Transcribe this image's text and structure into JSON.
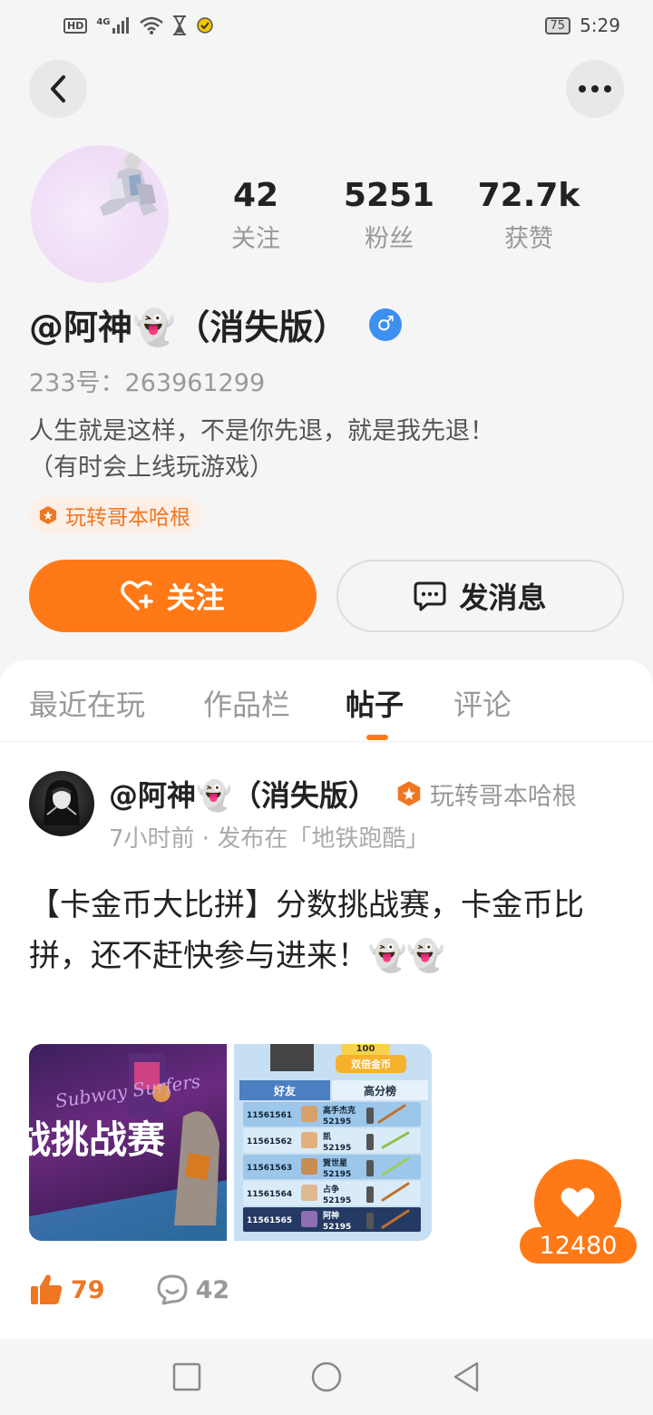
{
  "status_bar": {
    "left_icons": [
      "hd-icon",
      "4g-signal-icon",
      "wifi-icon",
      "hourglass-icon",
      "notification-icon"
    ],
    "hd_label": "HD",
    "network_label": "4G",
    "battery": "75",
    "time": "5:29"
  },
  "header": {
    "back_icon": "chevron-left-icon",
    "more_icon": "more-dots-icon"
  },
  "profile": {
    "stats": [
      {
        "value": "42",
        "label": "关注"
      },
      {
        "value": "5251",
        "label": "粉丝"
      },
      {
        "value": "72.7k",
        "label": "获赞"
      }
    ],
    "username": "@阿神👻（消失版）",
    "gender_icon": "male-icon",
    "gender_symbol": "♂",
    "id_line": "233号：263961299",
    "bio_line1": "人生就是这样，不是你先退，就是我先退！",
    "bio_line2": "（有时会上线玩游戏）",
    "title_badge": "玩转哥本哈根",
    "follow_label": "关注",
    "message_label": "发消息"
  },
  "tabs": [
    {
      "label": "最近在玩",
      "active": false
    },
    {
      "label": "作品栏",
      "active": false
    },
    {
      "label": "帖子",
      "active": true
    },
    {
      "label": "评论",
      "active": false
    }
  ],
  "post": {
    "author": "@阿神👻（消失版）",
    "author_title": "玩转哥本哈根",
    "meta": "7小时前 · 发布在「地铁跑酷」",
    "text": "【卡金币大比拼】分数挑战赛，卡金币比拼，还不赶快参与进来！👻👻",
    "image1": {
      "brand": "Subway Surfers",
      "headline": "战挑战赛"
    },
    "image2": {
      "top_value": "100",
      "double_coins": "双倍金币",
      "tab_friends": "好友",
      "tab_highscore": "高分榜",
      "rows": [
        {
          "id": "11561561",
          "name": "高手杰克",
          "score": "52195"
        },
        {
          "id": "11561562",
          "name": "凯",
          "score": "52195"
        },
        {
          "id": "11561563",
          "name": "賀世星",
          "score": "52195"
        },
        {
          "id": "11561564",
          "name": "占争",
          "score": "52195"
        },
        {
          "id": "11561565",
          "name": "阿神",
          "score": "52195"
        }
      ]
    },
    "likes": "79",
    "comments": "42"
  },
  "floating_like": {
    "count": "12480"
  },
  "colors": {
    "accent": "#ff7a17",
    "muted": "#999999",
    "gender_blue": "#3d8ff0"
  }
}
